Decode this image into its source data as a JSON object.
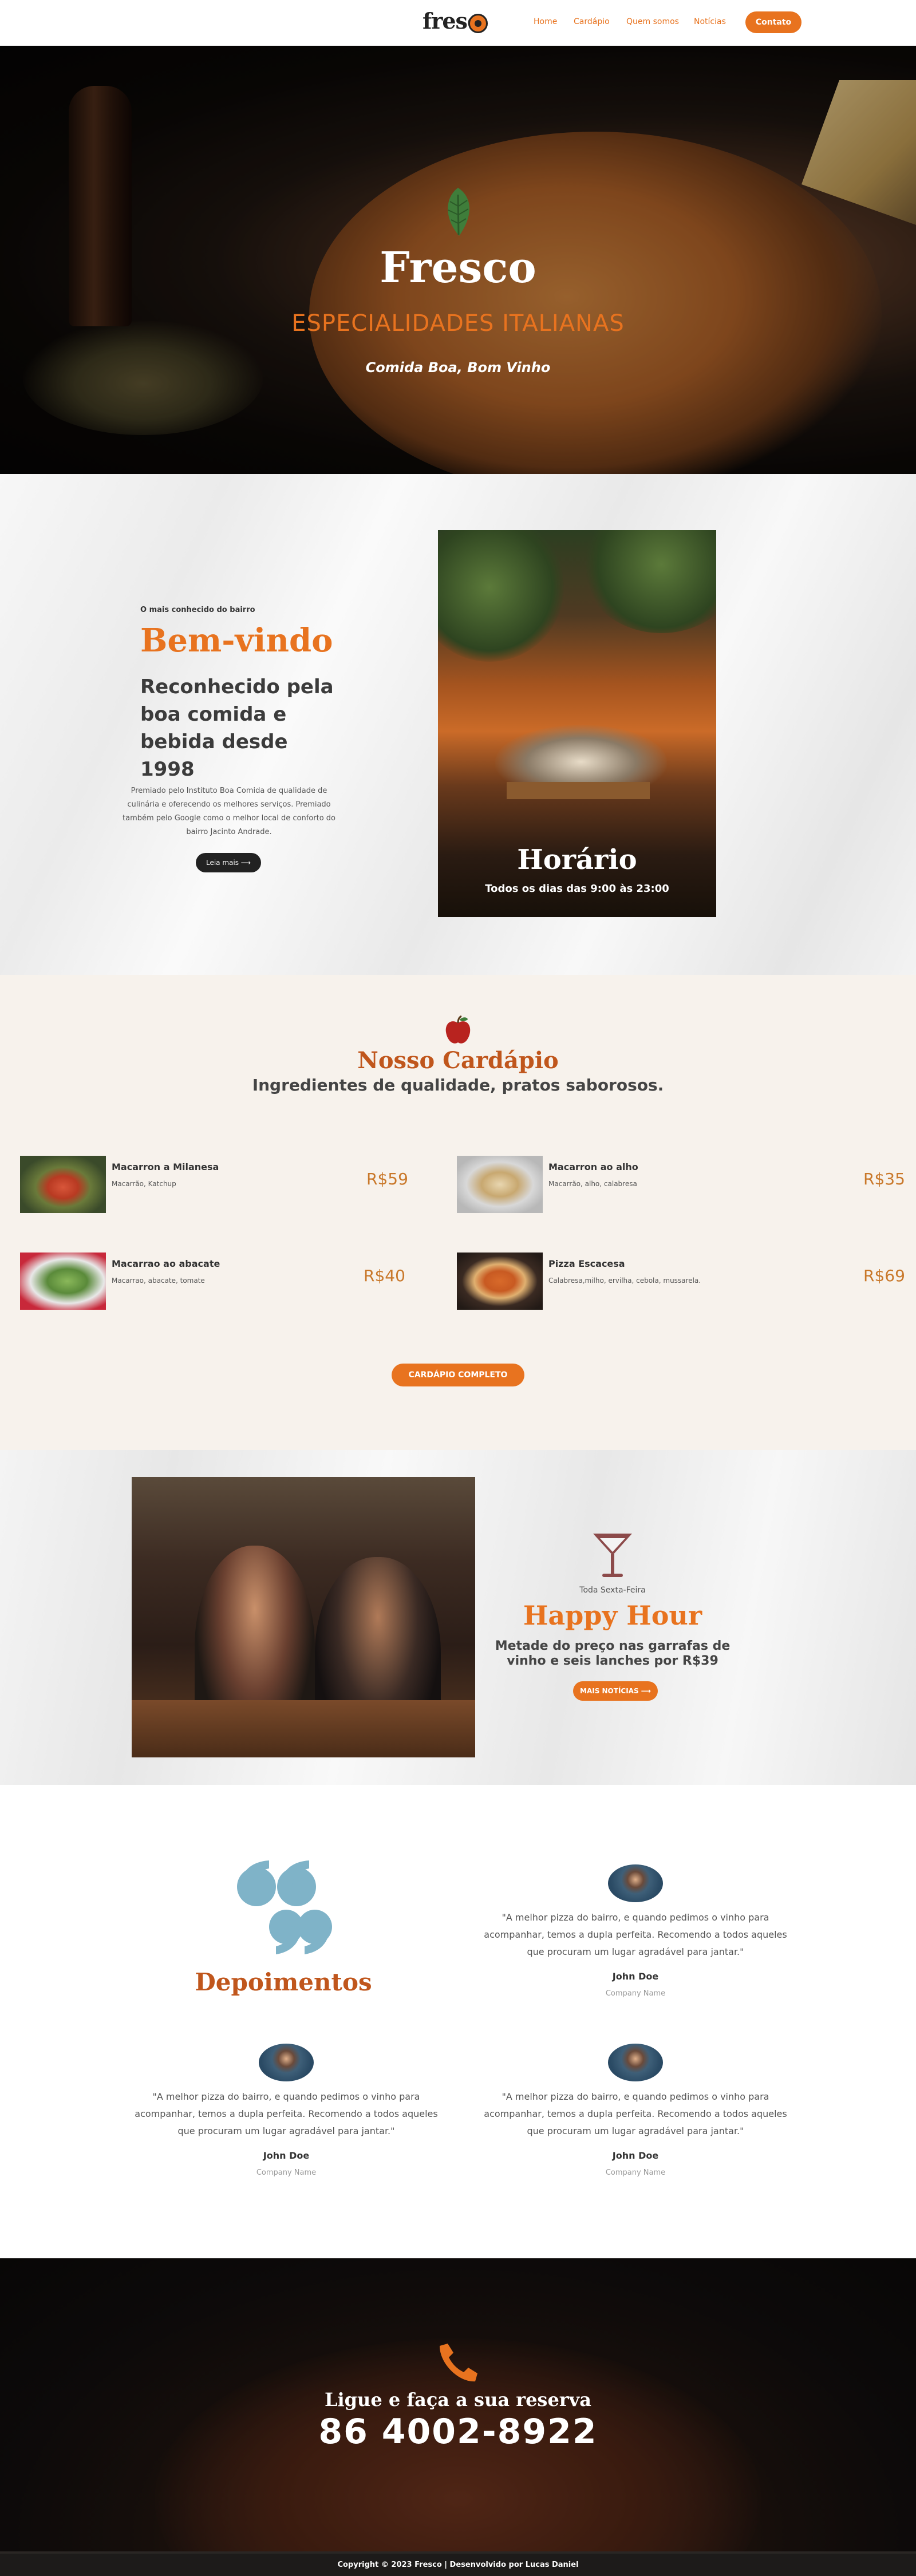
{
  "header": {
    "logo": "fresc",
    "nav": [
      "Home",
      "Cardápio",
      "Quem somos",
      "Notícias"
    ],
    "cta": "Contato"
  },
  "hero": {
    "title": "Fresco",
    "subtitle": "ESPECIALIDADES ITALIANAS",
    "tagline": "Comida Boa, Bom Vinho"
  },
  "welcome": {
    "kicker": "O mais conhecido do bairro",
    "title": "Bem-vindo",
    "heading": "Reconhecido pela boa comida e bebida desde 1998",
    "text": "Premiado pelo Instituto Boa Comida de qualidade de culinária e oferecendo os melhores serviços. Premiado também pelo Google como o melhor local de conforto do bairro Jacinto Andrade.",
    "button": "Leia mais ⟶",
    "hours_title": "Horário",
    "hours_text": "Todos os dias das 9:00 às 23:00"
  },
  "menu": {
    "title": "Nosso Cardápio",
    "subtitle": "Ingredientes de qualidade, pratos saborosos.",
    "items": [
      {
        "name": "Macarron a Milanesa",
        "desc": "Macarrão, Katchup",
        "price": "R$59"
      },
      {
        "name": "Macarron ao alho",
        "desc": "Macarrão, alho, calabresa",
        "price": "R$35"
      },
      {
        "name": "Macarrao ao abacate",
        "desc": "Macarrao, abacate, tomate",
        "price": "R$40"
      },
      {
        "name": "Pizza Escacesa",
        "desc": "Calabresa,milho, ervilha, cebola, mussarela.",
        "price": "R$69"
      }
    ],
    "button": "CARDÁPIO COMPLETO"
  },
  "happy": {
    "kicker": "Toda Sexta-Feira",
    "title": "Happy Hour",
    "text": "Metade do preço nas garrafas de vinho e seis lanches por R$39",
    "button": "MAIS NOTÍCIAS ⟶"
  },
  "testimonials": {
    "title": "Depoimentos",
    "items": [
      {
        "quote": "\"A melhor pizza do bairro, e quando pedimos o vinho para acompanhar, temos a dupla perfeita. Recomendo a todos aqueles que procuram um lugar agradável para jantar.\"",
        "name": "John Doe",
        "company": "Company Name"
      },
      {
        "quote": "\"A melhor pizza do bairro, e quando pedimos o vinho para acompanhar, temos a dupla perfeita. Recomendo a todos aqueles que procuram um lugar agradável para jantar.\"",
        "name": "John Doe",
        "company": "Company Name"
      },
      {
        "quote": "\"A melhor pizza do bairro, e quando pedimos o vinho para acompanhar, temos a dupla perfeita. Recomendo a todos aqueles que procuram um lugar agradável para jantar.\"",
        "name": "John Doe",
        "company": "Company Name"
      }
    ]
  },
  "call": {
    "title": "Ligue e faça a sua reserva",
    "number": "86 4002-8922"
  },
  "footer": {
    "text": "Copyright © 2023 Fresco | Desenvolvido por Lucas Daniel"
  },
  "icons": {
    "leaf": "leaf-icon",
    "apple": "apple-icon",
    "glass": "martini-glass-icon",
    "quote": "quote-icon",
    "phone": "phone-icon"
  },
  "colors": {
    "accent": "#e8731f",
    "accent_dark": "#c0561c",
    "cream": "#f7f2ec",
    "dark": "#1d1b1a",
    "quote_blue": "#7fb3c8",
    "glass": "#8c4a4a"
  }
}
